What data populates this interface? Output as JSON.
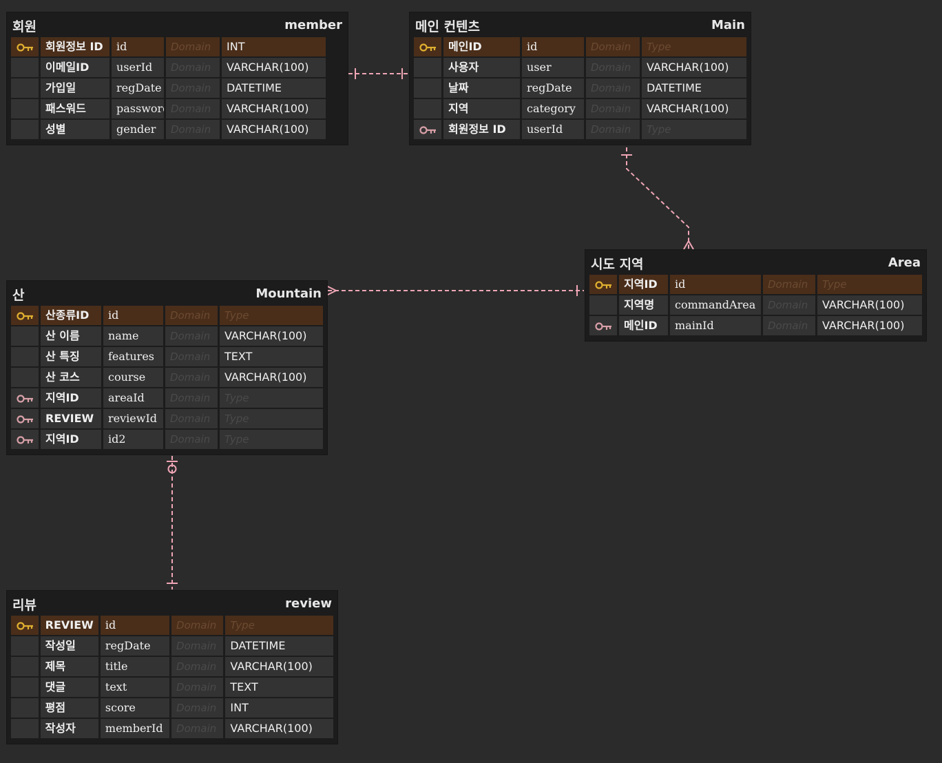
{
  "colors": {
    "background": "#2b2b2b",
    "table_bg": "#1c1c1c",
    "cell_bg": "#333333",
    "pk_row_bg": "#4a2e1a",
    "pk_key_icon": "#e0b030",
    "fk_key_icon": "#d8a0a8",
    "relation_line": "#f0a6b6"
  },
  "tables": {
    "member": {
      "logical": "회원",
      "physical": "member",
      "columns": [
        {
          "key": "pk",
          "logical": "회원정보 ID",
          "physical": "id",
          "domain": "Domain",
          "type": "INT"
        },
        {
          "key": "",
          "logical": "이메일ID",
          "physical": "userId",
          "domain": "Domain",
          "type": "VARCHAR(100)"
        },
        {
          "key": "",
          "logical": "가입일",
          "physical": "regDate",
          "domain": "Domain",
          "type": "DATETIME"
        },
        {
          "key": "",
          "logical": "패스워드",
          "physical": "password",
          "domain": "Domain",
          "type": "VARCHAR(100)"
        },
        {
          "key": "",
          "logical": "성별",
          "physical": "gender",
          "domain": "Domain",
          "type": "VARCHAR(100)"
        }
      ]
    },
    "main": {
      "logical": "메인 컨텐츠",
      "physical": "Main",
      "columns": [
        {
          "key": "pk",
          "logical": "메인ID",
          "physical": "id",
          "domain": "Domain",
          "type": "Type",
          "type_placeholder": true
        },
        {
          "key": "",
          "logical": "사용자",
          "physical": "user",
          "domain": "Domain",
          "type": "VARCHAR(100)"
        },
        {
          "key": "",
          "logical": "날짜",
          "physical": "regDate",
          "domain": "Domain",
          "type": "DATETIME"
        },
        {
          "key": "",
          "logical": "지역",
          "physical": "category",
          "domain": "Domain",
          "type": "VARCHAR(100)"
        },
        {
          "key": "fk",
          "logical": "회원정보 ID",
          "physical": "userId",
          "domain": "Domain",
          "type": "Type",
          "type_placeholder": true
        }
      ]
    },
    "area": {
      "logical": "시도 지역",
      "physical": "Area",
      "columns": [
        {
          "key": "pk",
          "logical": "지역ID",
          "physical": "id",
          "domain": "Domain",
          "type": "Type",
          "type_placeholder": true
        },
        {
          "key": "",
          "logical": "지역명",
          "physical": "commandArea",
          "domain": "Domain",
          "type": "VARCHAR(100)"
        },
        {
          "key": "fk",
          "logical": "메인ID",
          "physical": "mainId",
          "domain": "Domain",
          "type": "VARCHAR(100)"
        }
      ]
    },
    "mountain": {
      "logical": "산",
      "physical": "Mountain",
      "columns": [
        {
          "key": "pk",
          "logical": "산종류ID",
          "physical": "id",
          "domain": "Domain",
          "type": "Type",
          "type_placeholder": true
        },
        {
          "key": "",
          "logical": "산 이름",
          "physical": "name",
          "domain": "Domain",
          "type": "VARCHAR(100)"
        },
        {
          "key": "",
          "logical": "산 특징",
          "physical": "features",
          "domain": "Domain",
          "type": "TEXT"
        },
        {
          "key": "",
          "logical": "산 코스",
          "physical": "course",
          "domain": "Domain",
          "type": "VARCHAR(100)"
        },
        {
          "key": "fk",
          "logical": "지역ID",
          "physical": "areaId",
          "domain": "Domain",
          "type": "Type",
          "type_placeholder": true
        },
        {
          "key": "fk",
          "logical": "REVIEW",
          "physical": "reviewId",
          "domain": "Domain",
          "type": "Type",
          "type_placeholder": true
        },
        {
          "key": "fk",
          "logical": "지역ID",
          "physical": "id2",
          "domain": "Domain",
          "type": "Type",
          "type_placeholder": true
        }
      ]
    },
    "review": {
      "logical": "리뷰",
      "physical": "review",
      "columns": [
        {
          "key": "pk",
          "logical": "REVIEW",
          "physical": "id",
          "domain": "Domain",
          "type": "Type",
          "type_placeholder": true
        },
        {
          "key": "",
          "logical": "작성일",
          "physical": "regDate",
          "domain": "Domain",
          "type": "DATETIME"
        },
        {
          "key": "",
          "logical": "제목",
          "physical": "title",
          "domain": "Domain",
          "type": "VARCHAR(100)"
        },
        {
          "key": "",
          "logical": "댓글",
          "physical": "text",
          "domain": "Domain",
          "type": "TEXT"
        },
        {
          "key": "",
          "logical": "평점",
          "physical": "score",
          "domain": "Domain",
          "type": "INT"
        },
        {
          "key": "",
          "logical": "작성자",
          "physical": "memberId",
          "domain": "Domain",
          "type": "VARCHAR(100)"
        }
      ]
    }
  },
  "relations": [
    {
      "from": "member",
      "to": "main",
      "from_end": "one",
      "to_end": "one"
    },
    {
      "from": "main",
      "to": "area",
      "from_end": "one",
      "to_end": "many"
    },
    {
      "from": "mountain",
      "to": "area",
      "from_end": "many",
      "to_end": "one"
    },
    {
      "from": "mountain",
      "to": "review",
      "from_end": "zero-or-one",
      "to_end": "one"
    }
  ]
}
